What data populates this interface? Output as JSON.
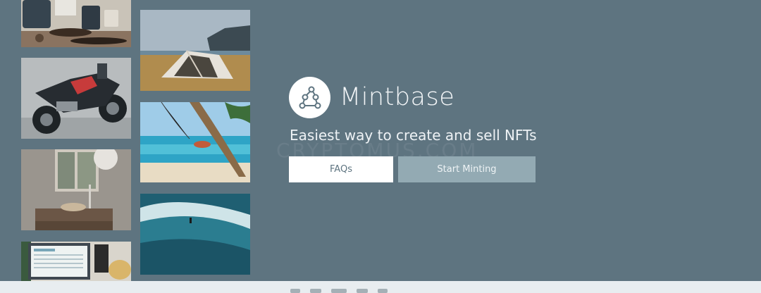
{
  "brand": {
    "name": "Mintbase",
    "tagline": "Easiest way to create and sell NFTs"
  },
  "buttons": {
    "faq_label": "FAQs",
    "start_label": "Start Minting"
  },
  "colors": {
    "background": "#5e7480",
    "secondary_button": "#93aab3",
    "primary_button": "#ffffff"
  },
  "photos": [
    {
      "subject": "coffee-brewing"
    },
    {
      "subject": "motorcycle"
    },
    {
      "subject": "washbasin-window"
    },
    {
      "subject": "laptop-desk"
    },
    {
      "subject": "camping-tent"
    },
    {
      "subject": "beach-hammock"
    },
    {
      "subject": "surfer-wave"
    }
  ],
  "icons": {
    "logo": "network-nodes-icon"
  }
}
